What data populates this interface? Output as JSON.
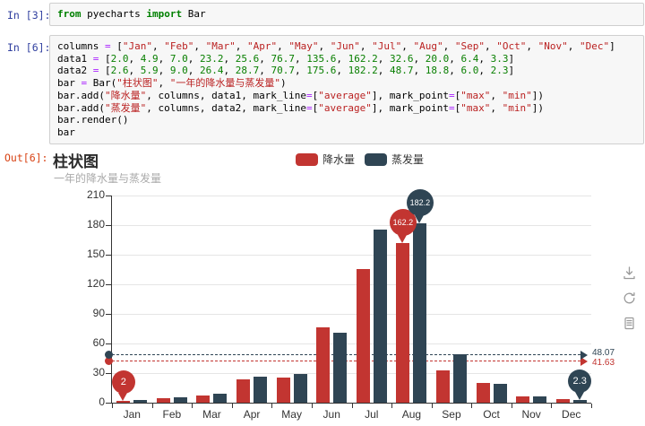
{
  "notebook": {
    "cells": [
      {
        "prompt": "In [3]:",
        "lines": [
          [
            [
              "k",
              "from"
            ],
            [
              "n",
              " pyecharts "
            ],
            [
              "k",
              "import"
            ],
            [
              "n",
              " Bar"
            ]
          ]
        ]
      },
      {
        "prompt": "In [6]:",
        "lines": [
          [
            [
              "n",
              "columns "
            ],
            [
              "o",
              "="
            ],
            [
              "n",
              " ["
            ],
            [
              "s",
              "\"Jan\""
            ],
            [
              "n",
              ", "
            ],
            [
              "s",
              "\"Feb\""
            ],
            [
              "n",
              ", "
            ],
            [
              "s",
              "\"Mar\""
            ],
            [
              "n",
              ", "
            ],
            [
              "s",
              "\"Apr\""
            ],
            [
              "n",
              ", "
            ],
            [
              "s",
              "\"May\""
            ],
            [
              "n",
              ", "
            ],
            [
              "s",
              "\"Jun\""
            ],
            [
              "n",
              ", "
            ],
            [
              "s",
              "\"Jul\""
            ],
            [
              "n",
              ", "
            ],
            [
              "s",
              "\"Aug\""
            ],
            [
              "n",
              ", "
            ],
            [
              "s",
              "\"Sep\""
            ],
            [
              "n",
              ", "
            ],
            [
              "s",
              "\"Oct\""
            ],
            [
              "n",
              ", "
            ],
            [
              "s",
              "\"Nov\""
            ],
            [
              "n",
              ", "
            ],
            [
              "s",
              "\"Dec\""
            ],
            [
              "n",
              "]"
            ]
          ],
          [
            [
              "n",
              "data1 "
            ],
            [
              "o",
              "="
            ],
            [
              "n",
              " ["
            ],
            [
              "m",
              "2.0"
            ],
            [
              "n",
              ", "
            ],
            [
              "m",
              "4.9"
            ],
            [
              "n",
              ", "
            ],
            [
              "m",
              "7.0"
            ],
            [
              "n",
              ", "
            ],
            [
              "m",
              "23.2"
            ],
            [
              "n",
              ", "
            ],
            [
              "m",
              "25.6"
            ],
            [
              "n",
              ", "
            ],
            [
              "m",
              "76.7"
            ],
            [
              "n",
              ", "
            ],
            [
              "m",
              "135.6"
            ],
            [
              "n",
              ", "
            ],
            [
              "m",
              "162.2"
            ],
            [
              "n",
              ", "
            ],
            [
              "m",
              "32.6"
            ],
            [
              "n",
              ", "
            ],
            [
              "m",
              "20.0"
            ],
            [
              "n",
              ", "
            ],
            [
              "m",
              "6.4"
            ],
            [
              "n",
              ", "
            ],
            [
              "m",
              "3.3"
            ],
            [
              "n",
              "]"
            ]
          ],
          [
            [
              "n",
              "data2 "
            ],
            [
              "o",
              "="
            ],
            [
              "n",
              " ["
            ],
            [
              "m",
              "2.6"
            ],
            [
              "n",
              ", "
            ],
            [
              "m",
              "5.9"
            ],
            [
              "n",
              ", "
            ],
            [
              "m",
              "9.0"
            ],
            [
              "n",
              ", "
            ],
            [
              "m",
              "26.4"
            ],
            [
              "n",
              ", "
            ],
            [
              "m",
              "28.7"
            ],
            [
              "n",
              ", "
            ],
            [
              "m",
              "70.7"
            ],
            [
              "n",
              ", "
            ],
            [
              "m",
              "175.6"
            ],
            [
              "n",
              ", "
            ],
            [
              "m",
              "182.2"
            ],
            [
              "n",
              ", "
            ],
            [
              "m",
              "48.7"
            ],
            [
              "n",
              ", "
            ],
            [
              "m",
              "18.8"
            ],
            [
              "n",
              ", "
            ],
            [
              "m",
              "6.0"
            ],
            [
              "n",
              ", "
            ],
            [
              "m",
              "2.3"
            ],
            [
              "n",
              "]"
            ]
          ],
          [
            [
              "n",
              "bar "
            ],
            [
              "o",
              "="
            ],
            [
              "n",
              " Bar("
            ],
            [
              "s",
              "\"柱状图\""
            ],
            [
              "n",
              ", "
            ],
            [
              "s",
              "\"一年的降水量与蒸发量\""
            ],
            [
              "n",
              ")"
            ]
          ],
          [
            [
              "n",
              "bar.add("
            ],
            [
              "s",
              "\"降水量\""
            ],
            [
              "n",
              ", columns, data1, mark_line"
            ],
            [
              "o",
              "="
            ],
            [
              "n",
              "["
            ],
            [
              "s",
              "\"average\""
            ],
            [
              "n",
              "], mark_point"
            ],
            [
              "o",
              "="
            ],
            [
              "n",
              "["
            ],
            [
              "s",
              "\"max\""
            ],
            [
              "n",
              ", "
            ],
            [
              "s",
              "\"min\""
            ],
            [
              "n",
              "])"
            ]
          ],
          [
            [
              "n",
              "bar.add("
            ],
            [
              "s",
              "\"蒸发量\""
            ],
            [
              "n",
              ", columns, data2, mark_line"
            ],
            [
              "o",
              "="
            ],
            [
              "n",
              "["
            ],
            [
              "s",
              "\"average\""
            ],
            [
              "n",
              "], mark_point"
            ],
            [
              "o",
              "="
            ],
            [
              "n",
              "["
            ],
            [
              "s",
              "\"max\""
            ],
            [
              "n",
              ", "
            ],
            [
              "s",
              "\"min\""
            ],
            [
              "n",
              "])"
            ]
          ],
          [
            [
              "n",
              "bar.render()"
            ]
          ],
          [
            [
              "n",
              "bar"
            ]
          ]
        ]
      }
    ],
    "output_prompt": "Out[6]:"
  },
  "chart_data": {
    "type": "bar",
    "title": "柱状图",
    "subtitle": "一年的降水量与蒸发量",
    "categories": [
      "Jan",
      "Feb",
      "Mar",
      "Apr",
      "May",
      "Jun",
      "Jul",
      "Aug",
      "Sep",
      "Oct",
      "Nov",
      "Dec"
    ],
    "series": [
      {
        "name": "降水量",
        "color": "#c23531",
        "values": [
          2.0,
          4.9,
          7.0,
          23.2,
          25.6,
          76.7,
          135.6,
          162.2,
          32.6,
          20.0,
          6.4,
          3.3
        ],
        "average": 41.63,
        "average_label": "41.63"
      },
      {
        "name": "蒸发量",
        "color": "#2f4554",
        "values": [
          2.6,
          5.9,
          9.0,
          26.4,
          28.7,
          70.7,
          175.6,
          182.2,
          48.7,
          18.8,
          6.0,
          2.3
        ],
        "average": 48.07,
        "average_label": "48.07"
      }
    ],
    "mark_points": [
      {
        "series": 0,
        "category": "Jan",
        "value": 2.0,
        "label": "2",
        "kind": "min"
      },
      {
        "series": 0,
        "category": "Aug",
        "value": 162.2,
        "label": "162.2",
        "kind": "max"
      },
      {
        "series": 1,
        "category": "Aug",
        "value": 182.2,
        "label": "182.2",
        "kind": "max"
      },
      {
        "series": 1,
        "category": "Dec",
        "value": 2.3,
        "label": "2.3",
        "kind": "min"
      }
    ],
    "ylim": [
      0,
      210
    ],
    "ytick_step": 30,
    "grid": true,
    "legend_position": "top-center",
    "toolbox_icons": [
      "save-as-image",
      "restore",
      "data-view"
    ]
  }
}
